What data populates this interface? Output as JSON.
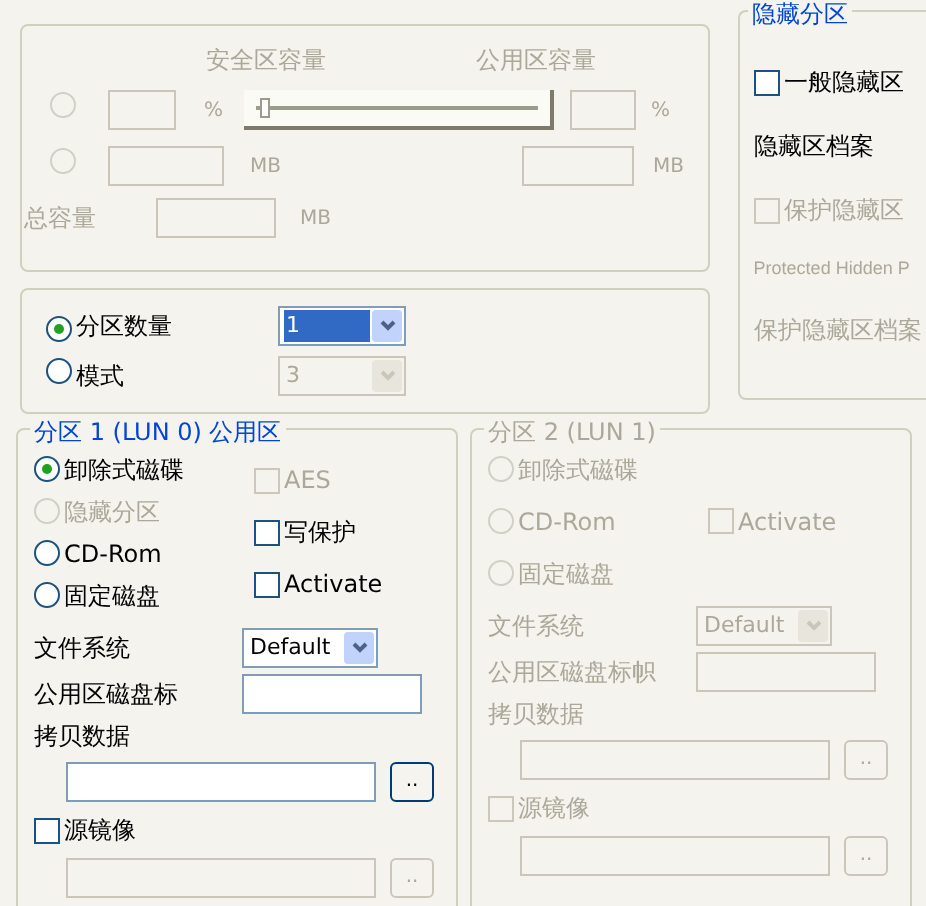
{
  "capacity": {
    "disabled": true,
    "secure_label": "安全区容量",
    "public_label": "公用区容量",
    "rows": [
      {
        "kind": "percent",
        "selected": false,
        "unit_left": "%",
        "unit_right": "%"
      },
      {
        "kind": "mb",
        "selected": false,
        "unit_left": "MB",
        "unit_right": "MB"
      }
    ],
    "slider": {
      "level": 0.02
    },
    "total_label": "总容量",
    "total_unit": "MB"
  },
  "hidden": {
    "title": "隐藏分区",
    "general": {
      "label": "一般隐藏区",
      "checked": false
    },
    "profile_label": "隐藏区档案",
    "protect": {
      "label": "保护隐藏区",
      "checked": false,
      "disabled": true
    },
    "protected_name": "Protected Hidden P",
    "protect_profile_label": "保护隐藏区档案"
  },
  "mode": {
    "options": [
      {
        "label": "分区数量",
        "selected": true,
        "value": "1",
        "disabled": false
      },
      {
        "label": "模式",
        "selected": false,
        "value": "3",
        "disabled": true
      }
    ]
  },
  "partitions": [
    {
      "title": "分区 1 (LUN 0) 公用区",
      "disabled": false,
      "types": [
        {
          "label": "卸除式磁碟",
          "selected": true,
          "disabled": false
        },
        {
          "label": "隐藏分区",
          "selected": false,
          "disabled": true
        },
        {
          "label": "CD-Rom",
          "selected": false,
          "disabled": false
        },
        {
          "label": "固定磁盘",
          "selected": false,
          "disabled": false
        }
      ],
      "options": [
        {
          "label": "AES",
          "checked": false,
          "disabled": true
        },
        {
          "label": "写保护",
          "checked": false,
          "disabled": false
        },
        {
          "label": "Activate",
          "checked": false,
          "disabled": false
        }
      ],
      "fs_label": "文件系统",
      "fs_value": "Default",
      "volume_label": "公用区磁盘标",
      "copy_label": "拷贝数据",
      "browse": "..",
      "mirror": {
        "label": "源镜像",
        "checked": false
      },
      "browse2": ".."
    },
    {
      "title": "分区 2 (LUN 1)",
      "disabled": true,
      "types": [
        {
          "label": "卸除式磁碟",
          "selected": false,
          "disabled": true
        },
        {
          "label": "CD-Rom",
          "selected": false,
          "disabled": true
        },
        {
          "label": "固定磁盘",
          "selected": false,
          "disabled": true
        }
      ],
      "options": [
        {
          "label": "Activate",
          "checked": false,
          "disabled": true
        }
      ],
      "fs_label": "文件系统",
      "fs_value": "Default",
      "volume_label": "公用区磁盘标帜",
      "copy_label": "拷贝数据",
      "browse": "..",
      "mirror": {
        "label": "源镜像",
        "checked": false
      },
      "browse2": ".."
    }
  ]
}
